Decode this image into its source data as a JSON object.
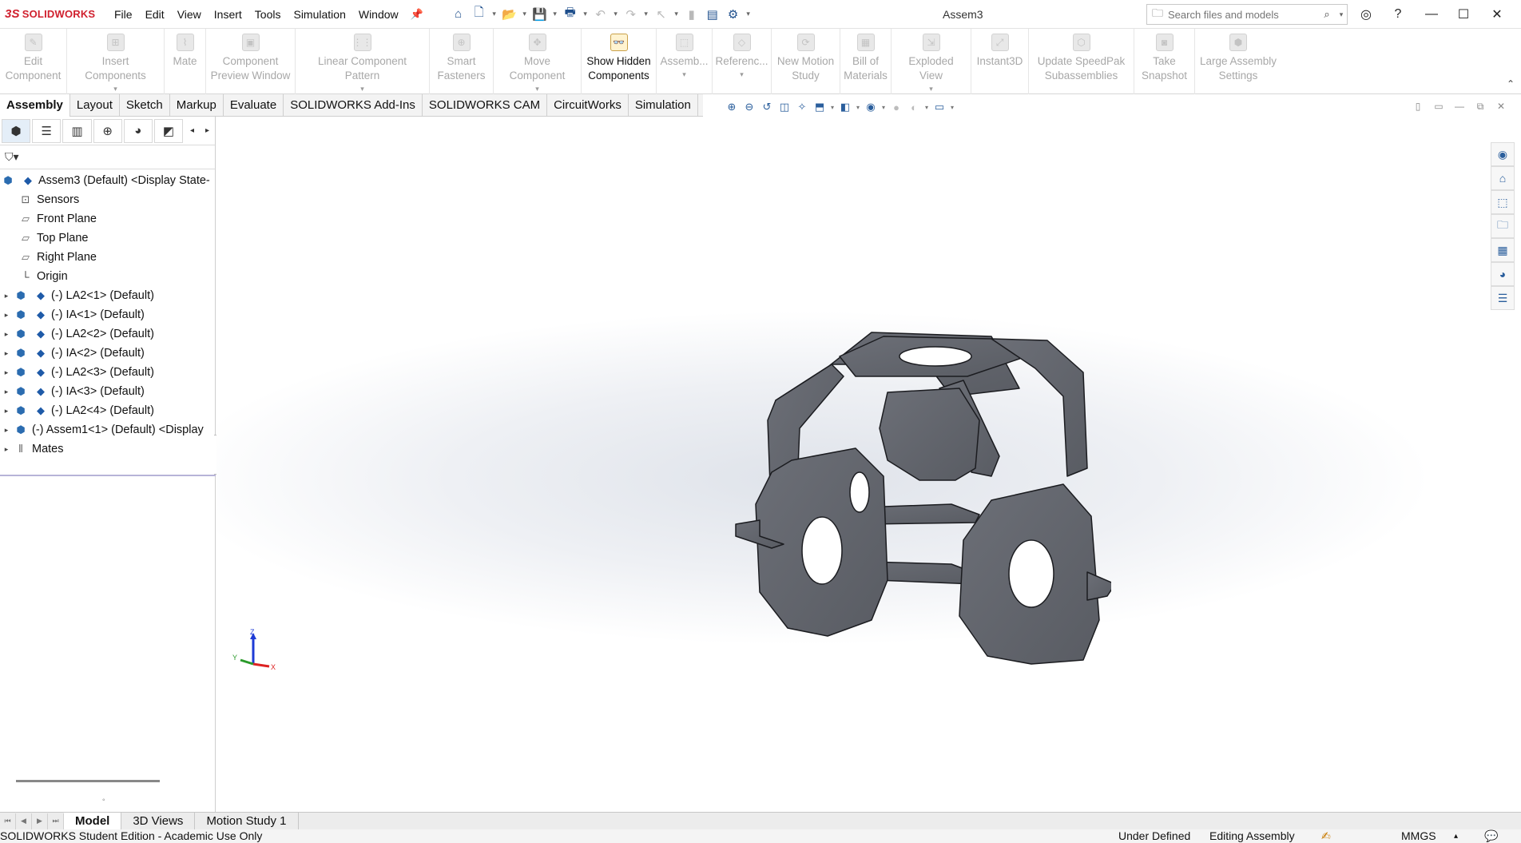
{
  "app": {
    "brand": "SOLIDWORKS",
    "brand_prefix": "3S",
    "document_title": "Assem3",
    "brand_color": "#d0202e"
  },
  "menu": [
    "File",
    "Edit",
    "View",
    "Insert",
    "Tools",
    "Simulation",
    "Window"
  ],
  "search": {
    "placeholder": "Search files and models"
  },
  "ribbon": [
    {
      "label1": "Edit",
      "label2": "Component",
      "arrow": false,
      "active": false
    },
    {
      "label1": "Insert Components",
      "label2": "",
      "arrow": true,
      "active": false
    },
    {
      "label1": "Mate",
      "label2": "",
      "arrow": false,
      "active": false
    },
    {
      "label1": "Component",
      "label2": "Preview Window",
      "arrow": false,
      "active": false
    },
    {
      "label1": "Linear Component Pattern",
      "label2": "",
      "arrow": true,
      "active": false
    },
    {
      "label1": "Smart",
      "label2": "Fasteners",
      "arrow": false,
      "active": false
    },
    {
      "label1": "Move Component",
      "label2": "",
      "arrow": true,
      "active": false
    },
    {
      "label1": "Show Hidden",
      "label2": "Components",
      "arrow": false,
      "active": true
    },
    {
      "label1": "Assemb...",
      "label2": "",
      "arrow": true,
      "active": false
    },
    {
      "label1": "Referenc...",
      "label2": "",
      "arrow": true,
      "active": false
    },
    {
      "label1": "New Motion",
      "label2": "Study",
      "arrow": false,
      "active": false
    },
    {
      "label1": "Bill of",
      "label2": "Materials",
      "arrow": false,
      "active": false
    },
    {
      "label1": "Exploded View",
      "label2": "",
      "arrow": true,
      "active": false
    },
    {
      "label1": "Instant3D",
      "label2": "",
      "arrow": false,
      "active": false
    },
    {
      "label1": "Update SpeedPak",
      "label2": "Subassemblies",
      "arrow": false,
      "active": false
    },
    {
      "label1": "Take",
      "label2": "Snapshot",
      "arrow": false,
      "active": false
    },
    {
      "label1": "Large Assembly",
      "label2": "Settings",
      "arrow": false,
      "active": false
    }
  ],
  "command_tabs": [
    "Assembly",
    "Layout",
    "Sketch",
    "Markup",
    "Evaluate",
    "SOLIDWORKS Add-Ins",
    "SOLIDWORKS CAM",
    "CircuitWorks",
    "Simulation"
  ],
  "tree": {
    "root": "Assem3 (Default) <Display State-",
    "items": [
      {
        "label": "Sensors",
        "kind": "sensor",
        "expandable": false
      },
      {
        "label": "Front Plane",
        "kind": "plane",
        "expandable": false
      },
      {
        "label": "Top Plane",
        "kind": "plane",
        "expandable": false
      },
      {
        "label": "Right Plane",
        "kind": "plane",
        "expandable": false
      },
      {
        "label": "Origin",
        "kind": "origin",
        "expandable": false
      },
      {
        "label": "(-) LA2<1> (Default)",
        "kind": "part",
        "expandable": true
      },
      {
        "label": "(-) IA<1> (Default)",
        "kind": "part",
        "expandable": true
      },
      {
        "label": "(-) LA2<2> (Default)",
        "kind": "part",
        "expandable": true
      },
      {
        "label": "(-) IA<2> (Default)",
        "kind": "part",
        "expandable": true
      },
      {
        "label": "(-) LA2<3> (Default)",
        "kind": "part",
        "expandable": true
      },
      {
        "label": "(-) IA<3> (Default)",
        "kind": "part",
        "expandable": true
      },
      {
        "label": "(-) LA2<4> (Default)",
        "kind": "part",
        "expandable": true
      },
      {
        "label": "(-) Assem1<1> (Default) <Display",
        "kind": "subasm",
        "expandable": true
      },
      {
        "label": "Mates",
        "kind": "mates",
        "expandable": true
      }
    ]
  },
  "bottom_tabs": [
    "Model",
    "3D Views",
    "Motion Study 1"
  ],
  "status": {
    "left": "SOLIDWORKS Student Edition - Academic Use Only",
    "definition": "Under Defined",
    "mode": "Editing Assembly",
    "units": "MMGS"
  },
  "triad": {
    "x": "X",
    "y": "Y",
    "z": "Z"
  }
}
